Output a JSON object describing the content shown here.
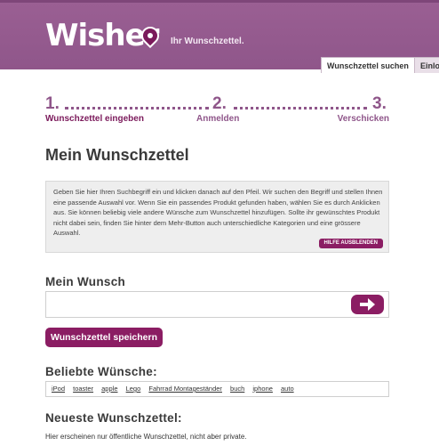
{
  "header": {
    "logo": "Wisher",
    "tagline": "Ihr Wunschzettel.",
    "tabs": [
      {
        "label": "Wunschzettel suchen"
      },
      {
        "label": "Einloggen"
      }
    ]
  },
  "steps": [
    {
      "number": "1.",
      "label": "Wunschzettel eingeben"
    },
    {
      "number": "2.",
      "label": "Anmelden"
    },
    {
      "number": "3.",
      "label": "Verschicken"
    }
  ],
  "page_title": "Mein Wunschzettel",
  "help": {
    "text": "Geben Sie hier Ihren Suchbegriff ein und klicken danach auf den Pfeil. Wir suchen den Begriff und stellen Ihnen eine passende Auswahl vor. Wenn Sie ein passendes Produkt gefunden haben, wählen Sie es durch Anklicken aus. Sie können beliebig viele andere Wünsche zum Wunschzettel hinzufügen. Sollte ihr gewünschtes Produkt nicht dabei sein, finden Sie hinter dem Mehr-Button auch unterschiedliche Kategorien und eine grössere Auswahl.",
    "hide_label": "HILFE AUSBLENDEN"
  },
  "wish": {
    "title": "Mein Wunsch",
    "input_value": "",
    "arrow_icon": "arrow-right-icon"
  },
  "save_label": "Wunschzettel speichern",
  "popular": {
    "title": "Beliebte Wünsche:",
    "tags": [
      "iPod",
      "toaster",
      "apple",
      "Lego",
      "Fahrrad Montageständer",
      "buch",
      "iphone",
      "auto"
    ]
  },
  "newest": {
    "title": "Neueste Wunschzettel:",
    "description": "Hier erscheinen nur öffentliche Wunschzettel, nicht aber private."
  },
  "colors": {
    "header": "#8f568a",
    "accent": "#8b1d63"
  }
}
